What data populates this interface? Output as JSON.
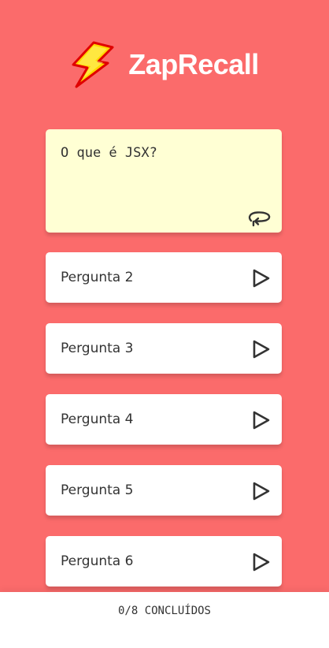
{
  "header": {
    "logo_icon": "lightning-bolt-icon",
    "title": "ZapRecall"
  },
  "colors": {
    "background": "#FB6B6B",
    "card_open": "#FFFFD4",
    "card_closed": "#FFFFFF",
    "text": "#333333",
    "logo_fill": "#FFD700",
    "logo_stroke": "#E00000"
  },
  "cards": {
    "open": {
      "question": "O que é JSX?",
      "action_icon": "turn-card-icon"
    },
    "closed": [
      {
        "label": "Pergunta 2",
        "action_icon": "play-icon"
      },
      {
        "label": "Pergunta 3",
        "action_icon": "play-icon"
      },
      {
        "label": "Pergunta 4",
        "action_icon": "play-icon"
      },
      {
        "label": "Pergunta 5",
        "action_icon": "play-icon"
      },
      {
        "label": "Pergunta 6",
        "action_icon": "play-icon"
      }
    ]
  },
  "footer": {
    "progress": "0/8 CONCLUÍDOS"
  }
}
